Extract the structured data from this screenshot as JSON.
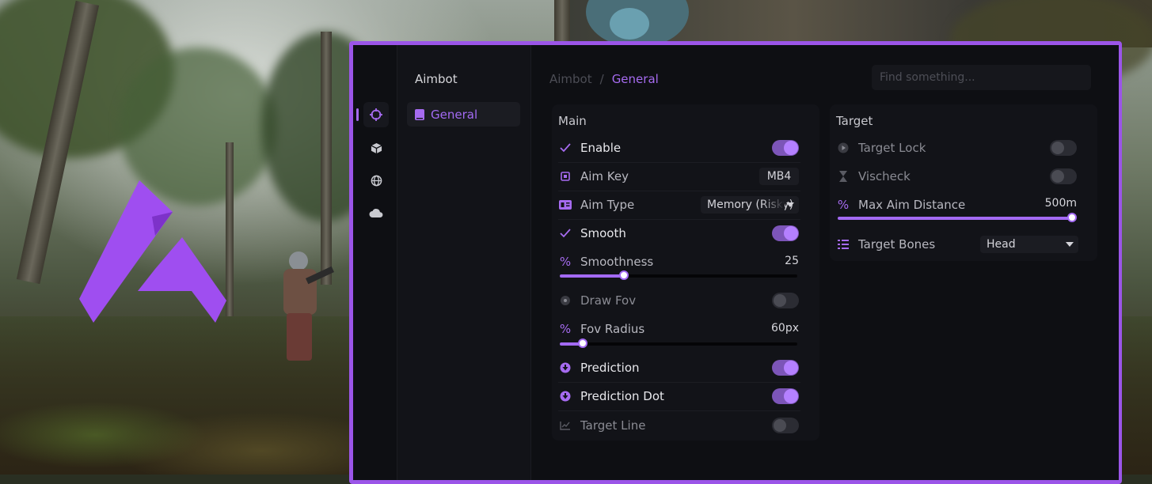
{
  "sidebar": {
    "title": "Aimbot",
    "icons": [
      "crosshair-icon",
      "cube-icon",
      "globe-icon",
      "cloud-icon"
    ],
    "items": [
      {
        "label": "General",
        "icon": "book-icon",
        "active": true
      }
    ]
  },
  "breadcrumb": {
    "root": "Aimbot",
    "separator": "/",
    "current": "General"
  },
  "search": {
    "placeholder": "Find something..."
  },
  "colors": {
    "accent": "#a36af3",
    "border": "#9b55e8",
    "panel": "#0e0f13",
    "card": "#121318"
  },
  "main": {
    "title": "Main",
    "enable": {
      "label": "Enable",
      "on": true
    },
    "aim_key": {
      "label": "Aim Key",
      "value": "MB4"
    },
    "aim_type": {
      "label": "Aim Type",
      "value": "Memory (Risky)"
    },
    "smooth": {
      "label": "Smooth",
      "on": true
    },
    "smoothness": {
      "label": "Smoothness",
      "value": "25",
      "fraction": 0.27
    },
    "draw_fov": {
      "label": "Draw Fov",
      "on": false
    },
    "fov_radius": {
      "label": "Fov Radius",
      "value": "60px",
      "fraction": 0.095
    },
    "prediction": {
      "label": "Prediction",
      "on": true
    },
    "prediction_dot": {
      "label": "Prediction Dot",
      "on": true
    },
    "target_line": {
      "label": "Target Line",
      "on": false
    }
  },
  "target": {
    "title": "Target",
    "target_lock": {
      "label": "Target Lock",
      "on": false
    },
    "vischeck": {
      "label": "Vischeck",
      "on": false
    },
    "max_aim_distance": {
      "label": "Max Aim Distance",
      "value": "500m",
      "fraction": 1.0
    },
    "target_bones": {
      "label": "Target Bones",
      "value": "Head"
    }
  }
}
